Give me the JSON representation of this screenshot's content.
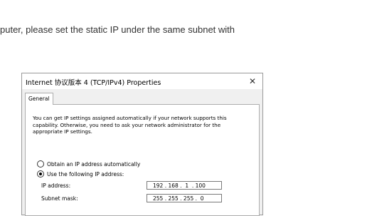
{
  "instruction_text": "puter, please set the static IP under the same subnet with",
  "dialog": {
    "title": "Internet 协议版本 4 (TCP/IPv4) Properties",
    "close_glyph": "✕",
    "tab_label": "General",
    "description": "You can get IP settings assigned automatically if your network supports this capability. Otherwise, you need to ask your network administrator for the appropriate IP settings.",
    "option_auto": "Obtain an IP address automatically",
    "option_manual": "Use the following IP address:",
    "ip_label": "IP address:",
    "ip_value": "192 . 168 .  1  . 100",
    "mask_label": "Subnet mask:",
    "mask_value": "255 . 255 . 255 .  0"
  }
}
